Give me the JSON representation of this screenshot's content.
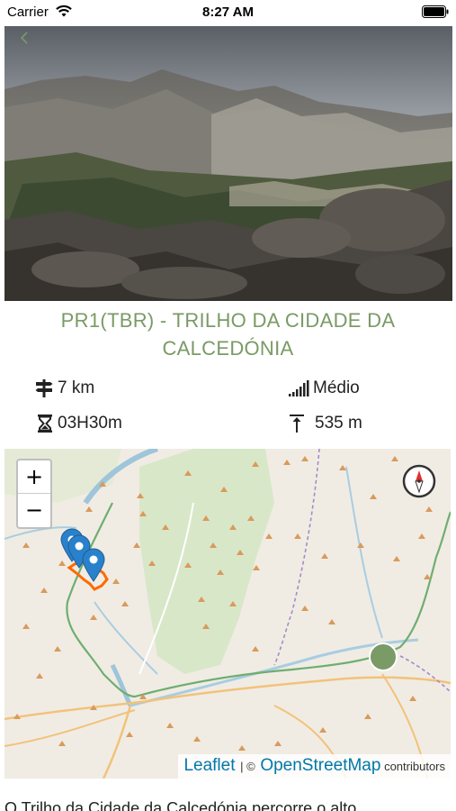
{
  "status_bar": {
    "carrier": "Carrier",
    "time": "8:27 AM"
  },
  "nav": {
    "back_icon": "chevron-left-icon"
  },
  "trail": {
    "title": "PR1(TBR) - TRILHO DA CIDADE DA CALCEDÓNIA",
    "distance": "7 km",
    "difficulty": "Médio",
    "duration": "03H30m",
    "elevation": "535 m",
    "description_preview": "O Trilho da Cidade da Calcedónia percorre o alto"
  },
  "map": {
    "zoom_in_label": "+",
    "zoom_out_label": "−",
    "attribution": {
      "leaflet": "Leaflet",
      "separator": "| ©",
      "osm": "OpenStreetMap",
      "contributors": "contributors"
    }
  },
  "colors": {
    "title": "#7a9a66",
    "link": "#0078a8",
    "route": "#ff6a00",
    "marker": "#2a81cb",
    "location_dot": "#7a9a66"
  },
  "icons": [
    "wifi-icon",
    "battery-icon",
    "chevron-left-icon",
    "signpost-icon",
    "signal-bars-icon",
    "hourglass-icon",
    "elevation-icon",
    "compass-icon",
    "map-marker-icon",
    "location-dot-icon"
  ]
}
